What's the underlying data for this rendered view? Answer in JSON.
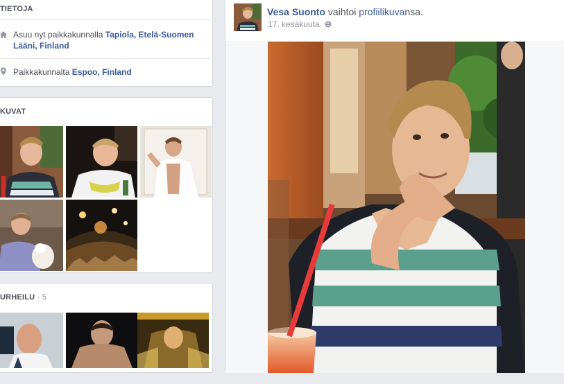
{
  "about": {
    "title": "TIETOJA",
    "lives_prefix": "Asuu nyt paikkakunnalla ",
    "lives_place_line1": "Tapiola, Etelä-Suomen",
    "lives_place_line2": "Lääni, Finland",
    "from_prefix": "Paikkakunnalta ",
    "from_place": "Espoo, Finland"
  },
  "photos": {
    "title": "KUVAT"
  },
  "sports": {
    "title": "URHEILU",
    "separator": "·",
    "count": "5"
  },
  "post": {
    "author": "Vesa Suonto",
    "action": " vaihtoi ",
    "object": "profiilikuva",
    "suffix": "nsa.",
    "date": "17. kesäkuuta"
  },
  "colors": {
    "link": "#3b5998",
    "page_bg": "#e9eaed",
    "card_border": "#d3d6db"
  }
}
